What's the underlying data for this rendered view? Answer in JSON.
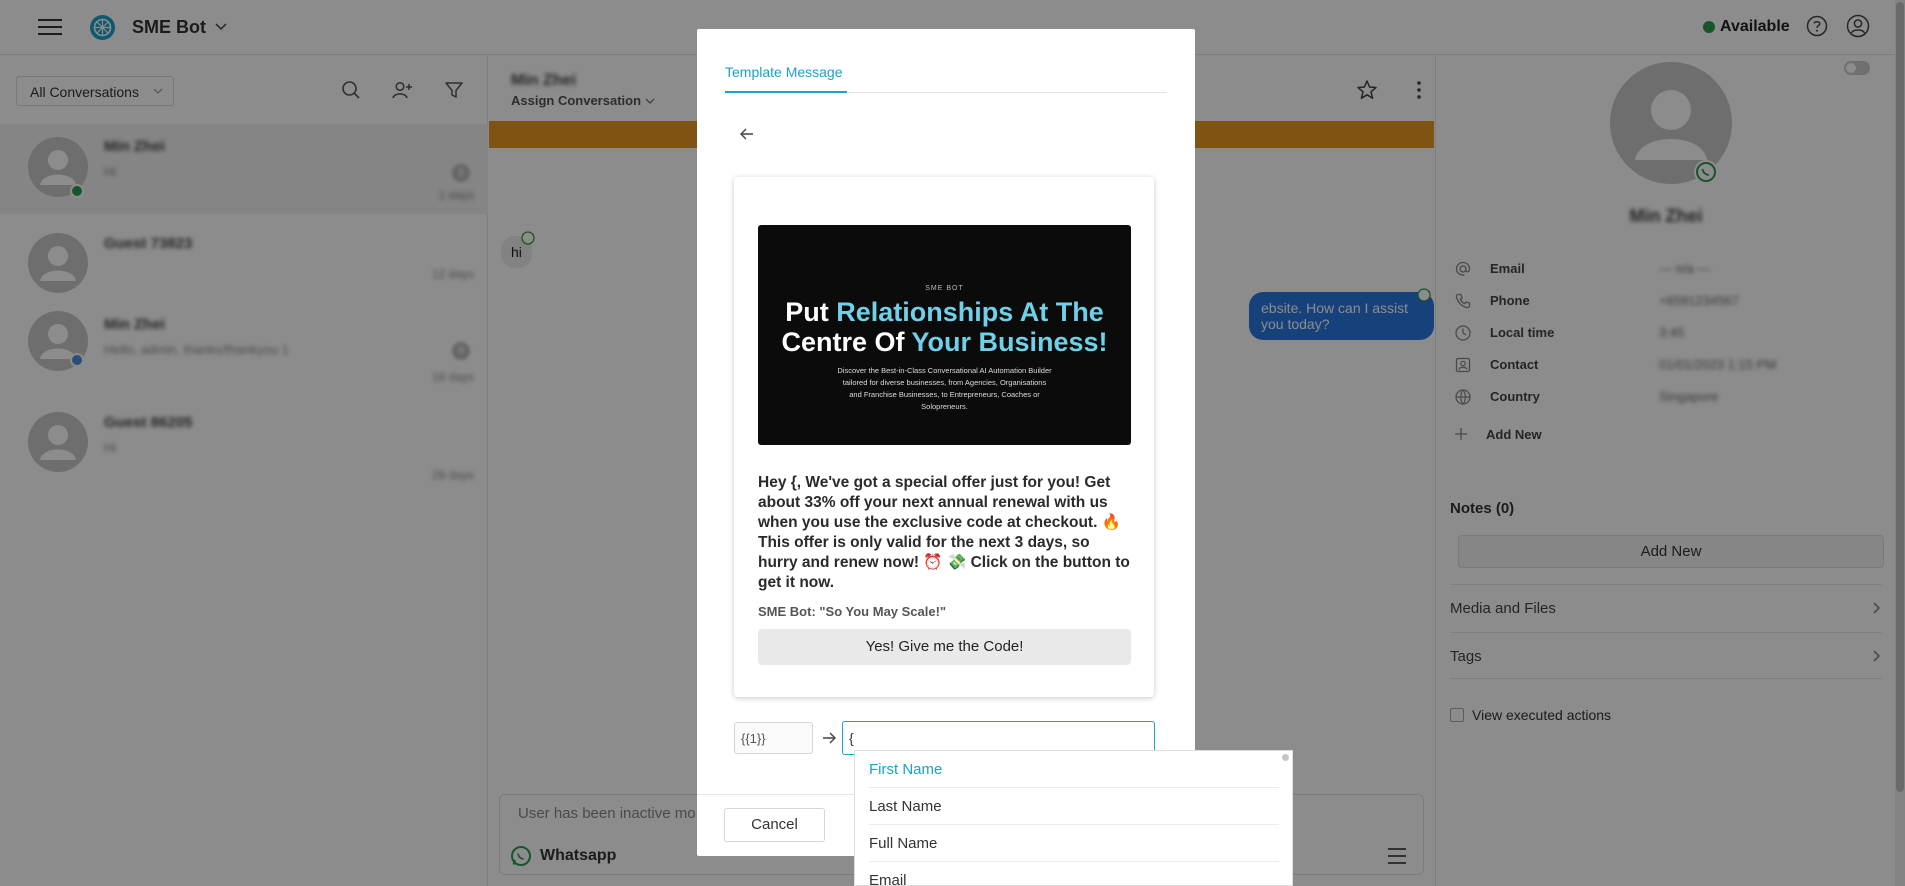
{
  "app": {
    "brand_name": "SME Bot",
    "status_label": "Available",
    "colors": {
      "accent": "#1aa2c9",
      "status_green": "#2e9b4f",
      "banner_orange": "#e89a24",
      "outgoing_bubble": "#2b77e0"
    }
  },
  "conversations": {
    "filter_label": "All Conversations",
    "items": [
      {
        "name": "Min Zhei",
        "message": "Hi",
        "time": "1 days",
        "badge": "8"
      },
      {
        "name": "Guest 73823",
        "message": "",
        "time": "12 days",
        "badge": ""
      },
      {
        "name": "Min Zhei",
        "message": "Hello, admin, thanks/thankyou 1",
        "time": "18 days",
        "badge": "8"
      },
      {
        "name": "Guest 86205",
        "message": "Hi",
        "time": "28 days",
        "badge": ""
      }
    ]
  },
  "chat": {
    "contact_name": "Min Zhei",
    "assign_label": "Assign Conversation",
    "incoming_message": "hi",
    "outgoing_message": "ebsite. How can I assist you today?",
    "composer_placeholder": "User has been inactive mo",
    "channel_label": "Whatsapp"
  },
  "contact": {
    "name": "Min Zhei",
    "fields": [
      {
        "label": "Email",
        "value": "— n/a —",
        "icon": "at-icon"
      },
      {
        "label": "Phone",
        "value": "+6591234567",
        "icon": "phone-icon"
      },
      {
        "label": "Local time",
        "value": "3:45",
        "icon": "clock-icon"
      },
      {
        "label": "Contact",
        "value": "01/01/2023 1:15 PM",
        "icon": "contact-card-icon"
      },
      {
        "label": "Country",
        "value": "Singapore",
        "icon": "globe-icon"
      }
    ],
    "add_new_label": "Add New",
    "notes_title": "Notes (0)",
    "notes_add_label": "Add New",
    "media_label": "Media and Files",
    "tags_label": "Tags",
    "executed_actions_label": "View executed actions"
  },
  "modal": {
    "tab_label": "Template Message",
    "preview": {
      "image_brand": "SME BOT",
      "image_headline_white_1": "Put ",
      "image_headline_blue_1": "Relationships At The",
      "image_headline_white_2": "Centre Of ",
      "image_headline_blue_2": "Your Business!",
      "image_subtext": "Discover the Best-in-Class Conversational AI Automation Builder tailored for diverse businesses, from Agencies, Organisations and Franchise Businesses, to Entrepreneurs, Coaches or Solopreneurs.",
      "body": "Hey {, We've got a special offer just for you! Get about 33% off your next annual renewal with us when you use the exclusive code at checkout. 🔥 This offer is only valid for the next 3 days, so hurry and renew now! ⏰ 💸 Click on the button to get it now.",
      "footer": "SME Bot: \"So You May Scale!\"",
      "button_label": "Yes! Give me the Code!"
    },
    "variable_token": "{{1}}",
    "variable_value": "{",
    "cancel_label": "Cancel"
  },
  "dropdown": {
    "options": [
      "First Name",
      "Last Name",
      "Full Name",
      "Email"
    ],
    "selected_index": 0
  }
}
